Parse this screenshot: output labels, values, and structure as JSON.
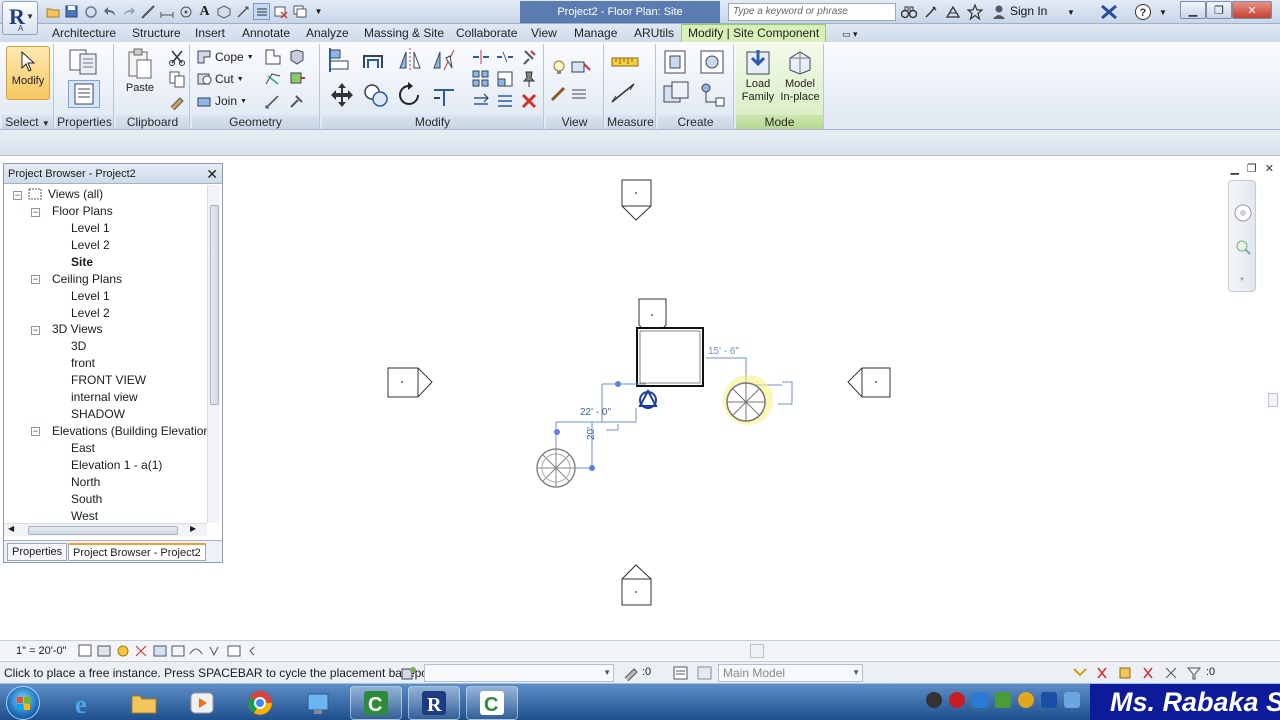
{
  "title_bar": {
    "document_title": "Project2 - Floor Plan: Site",
    "search_placeholder": "Type a keyword or phrase",
    "sign_in": "Sign In",
    "app_menu_sub": "A"
  },
  "ribbon": {
    "tabs": [
      "Architecture",
      "Structure",
      "Insert",
      "Annotate",
      "Analyze",
      "Massing & Site",
      "Collaborate",
      "View",
      "Manage",
      "ARUtils"
    ],
    "active_tab": "Modify | Site Component",
    "select_panel": {
      "button": "Modify",
      "label": "Select"
    },
    "properties_panel": {
      "label": "Properties"
    },
    "clipboard_panel": {
      "paste": "Paste",
      "label": "Clipboard"
    },
    "geometry_panel": {
      "cope": "Cope",
      "cut": "Cut",
      "join": "Join",
      "label": "Geometry"
    },
    "modify_panel": {
      "label": "Modify"
    },
    "view_panel": {
      "label": "View"
    },
    "measure_panel": {
      "label": "Measure"
    },
    "create_panel": {
      "label": "Create"
    },
    "mode_panel": {
      "load_family_1": "Load",
      "load_family_2": "Family",
      "model_inplace_1": "Model",
      "model_inplace_2": "In-place",
      "label": "Mode"
    }
  },
  "project_browser": {
    "title": "Project Browser - Project2",
    "tree": {
      "root": "Views (all)",
      "floor_plans": "Floor Plans",
      "fp_level1": "Level 1",
      "fp_level2": "Level 2",
      "fp_site": "Site",
      "ceiling_plans": "Ceiling Plans",
      "cp_level1": "Level 1",
      "cp_level2": "Level 2",
      "views_3d": "3D Views",
      "v3d": "3D",
      "vfront": "front",
      "vfront_view": "FRONT VIEW",
      "vinternal": "internal view",
      "vshadow": "SHADOW",
      "elevations": "Elevations (Building Elevation",
      "e_east": "East",
      "e_elev1": "Elevation 1 - a(1)",
      "e_north": "North",
      "e_south": "South",
      "e_west": "West"
    },
    "tabs": [
      "Properties",
      "Project Browser - Project2"
    ]
  },
  "drawing": {
    "dim_top": "15' - 6\"",
    "dim_left": "22' - 0\"",
    "dim_vert": "20'"
  },
  "view_bar": {
    "scale": "1\" = 20'-0\""
  },
  "status_bar": {
    "message": "Click to place a free instance. Press SPACEBAR to cycle the placement basepoin",
    "selection_count": ":0",
    "model": "Main Model",
    "filter_count": ":0"
  },
  "banner": {
    "text": "Ms. Rabaka S"
  },
  "colors": {
    "title_active": "#5b7cb1",
    "contextual_tab": "#d7f0b8",
    "selection_blue": "#5b83d9",
    "taskbar": "#1d4f8d",
    "banner": "#0d1b9a"
  }
}
